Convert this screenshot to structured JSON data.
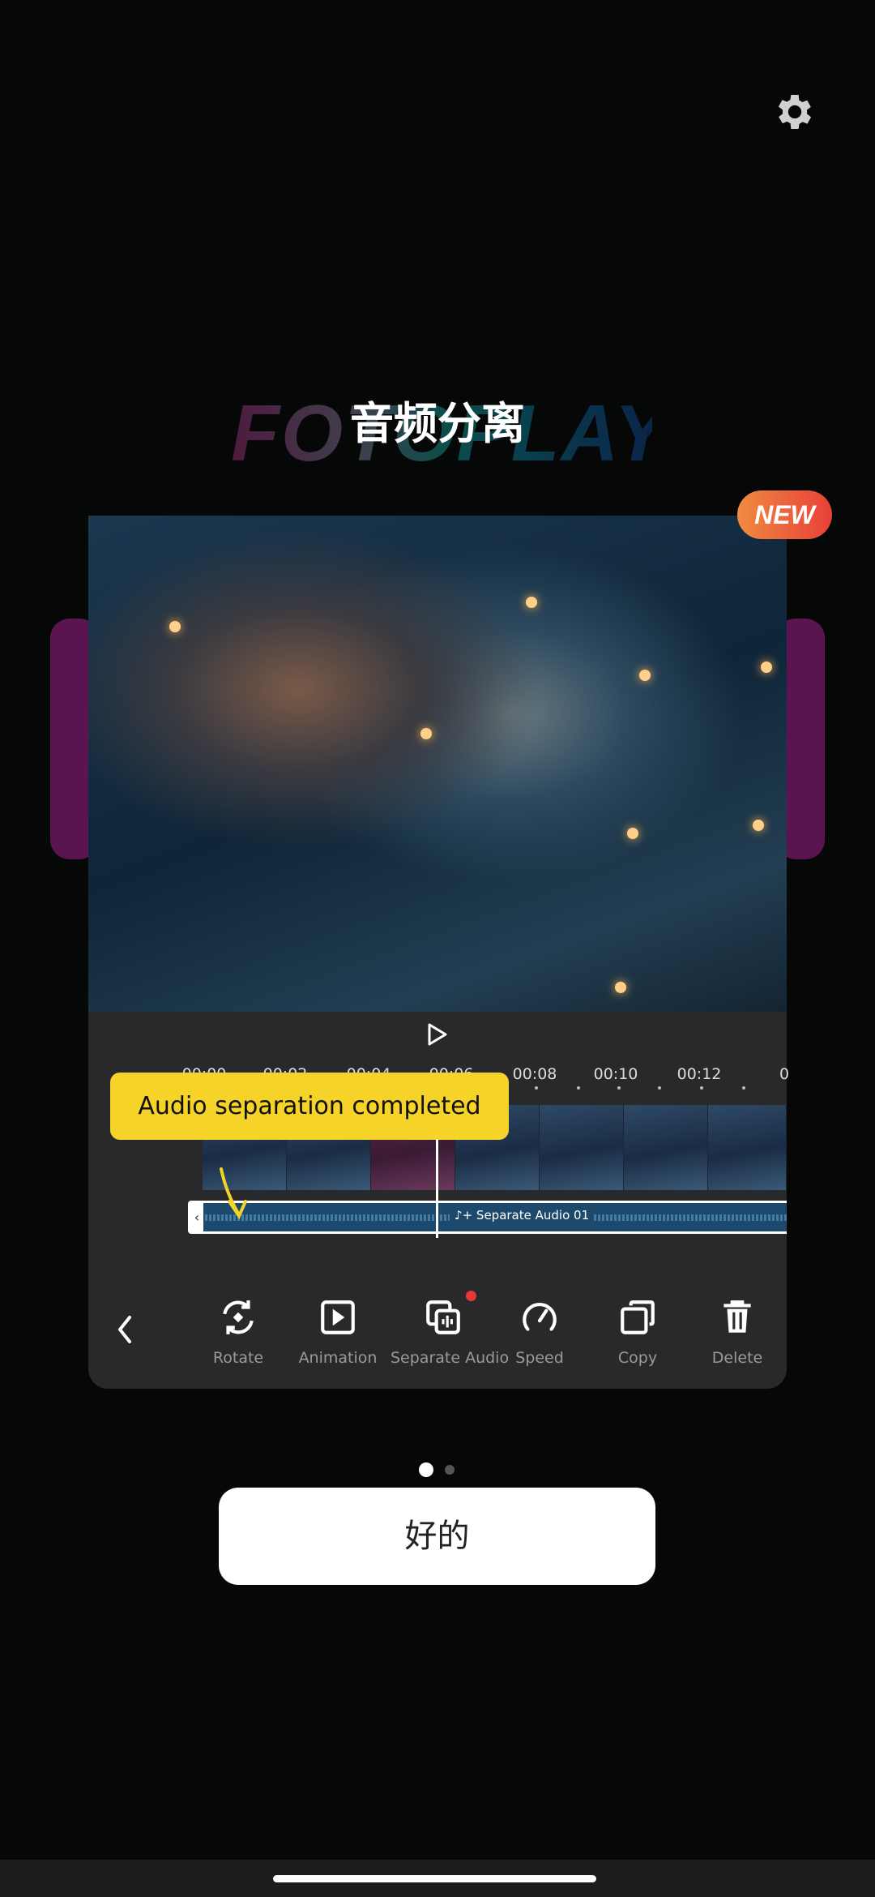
{
  "header": {
    "title": "音频分离",
    "watermark": "FOTOPLAY",
    "settings_icon": "gear-icon"
  },
  "badge": "NEW",
  "timeline": {
    "ticks": [
      "00:00",
      "00:02",
      "00:04",
      "00:06",
      "00:08",
      "00:10",
      "00:12",
      "0"
    ],
    "tooltip": "Audio separation completed",
    "audio_track_label": "Separate Audio 01"
  },
  "toolbar": {
    "items": [
      {
        "label": "Rotate",
        "icon": "rotate-icon"
      },
      {
        "label": "Animation",
        "icon": "animation-icon"
      },
      {
        "label": "Separate Audio",
        "icon": "separate-audio-icon",
        "badge_dot": true
      },
      {
        "label": "Speed",
        "icon": "speed-icon"
      },
      {
        "label": "Copy",
        "icon": "copy-icon"
      },
      {
        "label": "Delete",
        "icon": "delete-icon"
      }
    ]
  },
  "pager": {
    "count": 2,
    "active": 1
  },
  "confirm_button": "好的",
  "colors": {
    "tooltip": "#f5d328",
    "badge_dot": "#e53935",
    "audio_track": "#1d4a6c",
    "panel": "#29292b"
  }
}
